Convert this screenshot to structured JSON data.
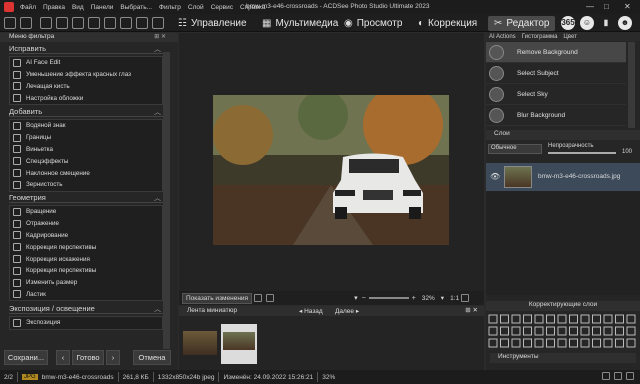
{
  "menu": {
    "items": [
      "Файл",
      "Правка",
      "Вид",
      "Панели",
      "Выбрать...",
      "Фильтр",
      "Слой",
      "Сервис",
      "Справка"
    ],
    "window_title": "bmw-m3-e46-crossroads - ACDSee Photo Studio Ultimate 2023"
  },
  "modes": {
    "manage": "Управление",
    "media": "Мультимедиа",
    "view": "Просмотр",
    "develop": "Коррекция",
    "edit": "Редактор",
    "r1": "365"
  },
  "left_panel": {
    "title": "Меню фильтра",
    "groups": [
      {
        "title": "Исправить",
        "items": [
          "AI Face Edit",
          "Уменьшение эффекта красных глаз",
          "Лечащая кисть",
          "Настройка обложки"
        ]
      },
      {
        "title": "Добавить",
        "items": [
          "Водяной знак",
          "Границы",
          "Виньетка",
          "Спецэффекты",
          "Наклонное смещение",
          "Зернистость"
        ]
      },
      {
        "title": "Геометрия",
        "items": [
          "Вращение",
          "Отражение",
          "Кадрирование",
          "Коррекция перспективы",
          "Коррекция искажения",
          "Коррекция перспективы",
          "Изменить размер",
          "Ластик"
        ]
      },
      {
        "title": "Экспозиция / освещение",
        "items": [
          "Экспозиция"
        ]
      }
    ],
    "save": "Сохрани...",
    "done": "Готово",
    "cancel": "Отмена"
  },
  "center": {
    "show_changes": "Показать изменения",
    "zoom": "32%",
    "ratio": "1:1",
    "strip_title": "Лента миниатюр",
    "back": "Назад",
    "forward": "Далее"
  },
  "right_panel": {
    "tabs": [
      "AI Actions",
      "Гистограмма",
      "Цвет"
    ],
    "actions": [
      {
        "label": "Remove Background",
        "selected": true
      },
      {
        "label": "Select Subject",
        "selected": false
      },
      {
        "label": "Select Sky",
        "selected": false
      },
      {
        "label": "Blur Background",
        "selected": false
      }
    ],
    "layers_title": "Слои",
    "blend": "Обычное",
    "opacity_label": "Непрозрачность",
    "opacity_value": "100",
    "layer_name": "bmw-m3-e46-crossroads.jpg",
    "adjust_title": "Корректирующие слои",
    "edit_tools_title": "Инструменты"
  },
  "status": {
    "page": "2/2",
    "format": "JPG",
    "filename": "bmw-m3-e46-crossroads",
    "size": "261,8 КБ",
    "dims": "1332x850x24b jpeg",
    "modified": "Изменён: 24.09.2022 15:26:21",
    "zoom": "32%"
  }
}
